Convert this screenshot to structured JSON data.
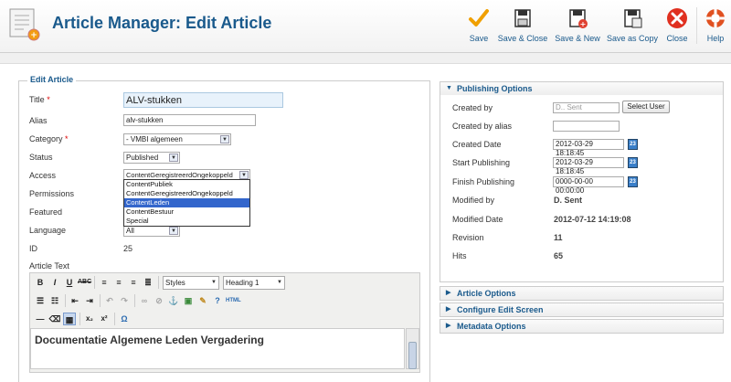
{
  "header": {
    "title": "Article Manager: Edit Article",
    "toolbar": [
      {
        "label": "Save",
        "icon": "check-icon",
        "color": "#f0a000"
      },
      {
        "label": "Save & Close",
        "icon": "floppy-icon",
        "color": "#333333"
      },
      {
        "label": "Save & New",
        "icon": "floppy-plus-icon",
        "color": "#333333"
      },
      {
        "label": "Save as Copy",
        "icon": "floppy-copy-icon",
        "color": "#333333"
      },
      {
        "label": "Close",
        "icon": "close-icon",
        "color": "#e03020"
      },
      {
        "label": "Help",
        "icon": "lifebuoy-icon",
        "color": "#e05020"
      }
    ]
  },
  "edit": {
    "legend": "Edit Article",
    "title_label": "Title",
    "title_value": "ALV-stukken",
    "alias_label": "Alias",
    "alias_value": "alv-stukken",
    "category_label": "Category",
    "category_value": "- VMBI algemeen",
    "status_label": "Status",
    "status_value": "Published",
    "access_label": "Access",
    "access_value": "ContentGeregistreerdOngekoppeld",
    "access_options": [
      "ContentPubliek",
      "ContentGeregistreerdOngekoppeld",
      "ContentLeden",
      "ContentBestuur",
      "Special"
    ],
    "access_selected_index": 2,
    "permissions_label": "Permissions",
    "featured_label": "Featured",
    "language_label": "Language",
    "language_value": "All",
    "id_label": "ID",
    "id_value": "25",
    "article_text_label": "Article Text",
    "styles_value": "Styles",
    "heading_value": "Heading 1",
    "editor_text": "Documentatie Algemene Leden Vergadering"
  },
  "publishing": {
    "heading": "Publishing Options",
    "created_by_label": "Created by",
    "created_by_value": "D.. Sent",
    "select_user_label": "Select User",
    "created_by_alias_label": "Created by alias",
    "created_by_alias_value": "",
    "created_date_label": "Created Date",
    "created_date_value": "2012-03-29 18:18:45",
    "start_publishing_label": "Start Publishing",
    "start_publishing_value": "2012-03-29 18:18:45",
    "finish_publishing_label": "Finish Publishing",
    "finish_publishing_value": "0000-00-00 00:00:00",
    "modified_by_label": "Modified by",
    "modified_by_value": "D. Sent",
    "modified_date_label": "Modified Date",
    "modified_date_value": "2012-07-12 14:19:08",
    "revision_label": "Revision",
    "revision_value": "11",
    "hits_label": "Hits",
    "hits_value": "65"
  },
  "panels": {
    "article_options": "Article Options",
    "configure_edit_screen": "Configure Edit Screen",
    "metadata_options": "Metadata Options"
  }
}
